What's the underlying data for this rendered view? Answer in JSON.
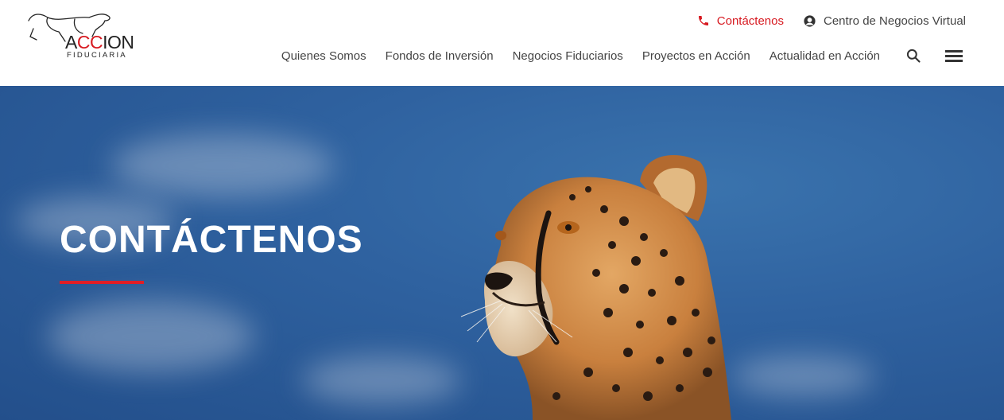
{
  "logo": {
    "prefix_black": "A",
    "prefix_red": "CC",
    "suffix": "ION",
    "subtitle": "FIDUCIARIA"
  },
  "top_links": {
    "contact": "Contáctenos",
    "virtual_center": "Centro de Negocios Virtual"
  },
  "nav": {
    "items": [
      "Quienes Somos",
      "Fondos de Inversión",
      "Negocios Fiduciarios",
      "Proyectos en Acción",
      "Actualidad en Acción"
    ]
  },
  "icons": {
    "phone": "phone-icon",
    "user": "user-icon",
    "search": "search-icon",
    "menu": "hamburger-menu-icon"
  },
  "hero": {
    "title": "CONTÁCTENOS"
  },
  "colors": {
    "accent_red": "#d71920",
    "sky_blue": "#2f62a0",
    "text_gray": "#444444"
  }
}
